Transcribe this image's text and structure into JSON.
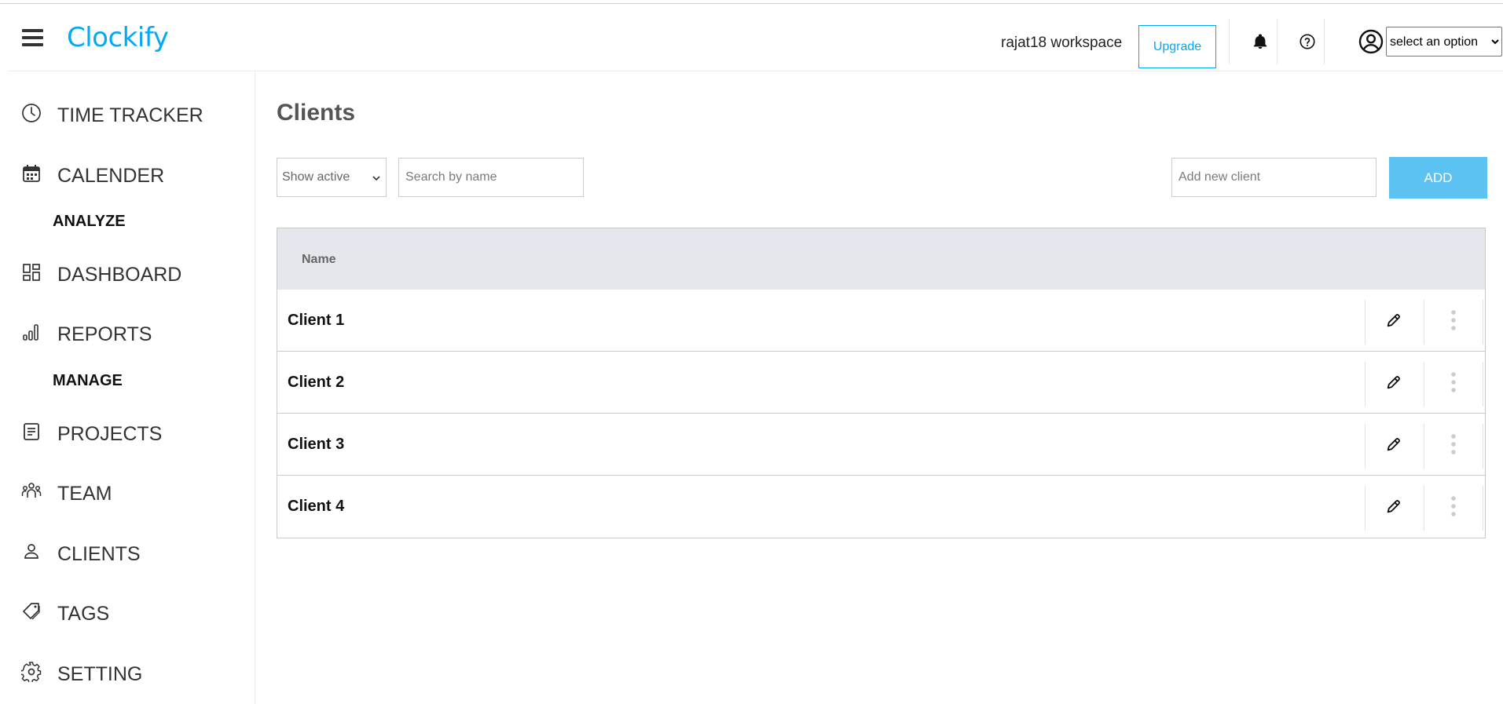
{
  "header": {
    "logo_text": "Clockify",
    "workspace": "rajat18 workspace",
    "upgrade_label": "Upgrade",
    "user_select_value": "select an option",
    "accent_color": "#03a9f4"
  },
  "sidebar": {
    "items": [
      {
        "label": "TIME TRACKER",
        "icon": "clock-icon"
      },
      {
        "label": "CALENDER",
        "icon": "calendar-icon"
      },
      {
        "label": "DASHBOARD",
        "icon": "dashboard-icon"
      },
      {
        "label": "REPORTS",
        "icon": "bar-chart-icon"
      },
      {
        "label": "PROJECTS",
        "icon": "document-icon"
      },
      {
        "label": "TEAM",
        "icon": "team-icon"
      },
      {
        "label": "CLIENTS",
        "icon": "person-icon"
      },
      {
        "label": "TAGS",
        "icon": "tag-icon"
      },
      {
        "label": "SETTING",
        "icon": "gear-icon"
      }
    ],
    "sections": {
      "analyze": "ANALYZE",
      "manage": "MANAGE"
    }
  },
  "main": {
    "title": "Clients",
    "filter_value": "Show active",
    "search_placeholder": "Search by name",
    "new_client_placeholder": "Add new client",
    "add_label": "ADD",
    "table": {
      "header_name": "Name",
      "rows": [
        {
          "name": "Client 1"
        },
        {
          "name": "Client 2"
        },
        {
          "name": "Client 3"
        },
        {
          "name": "Client 4"
        }
      ]
    }
  }
}
